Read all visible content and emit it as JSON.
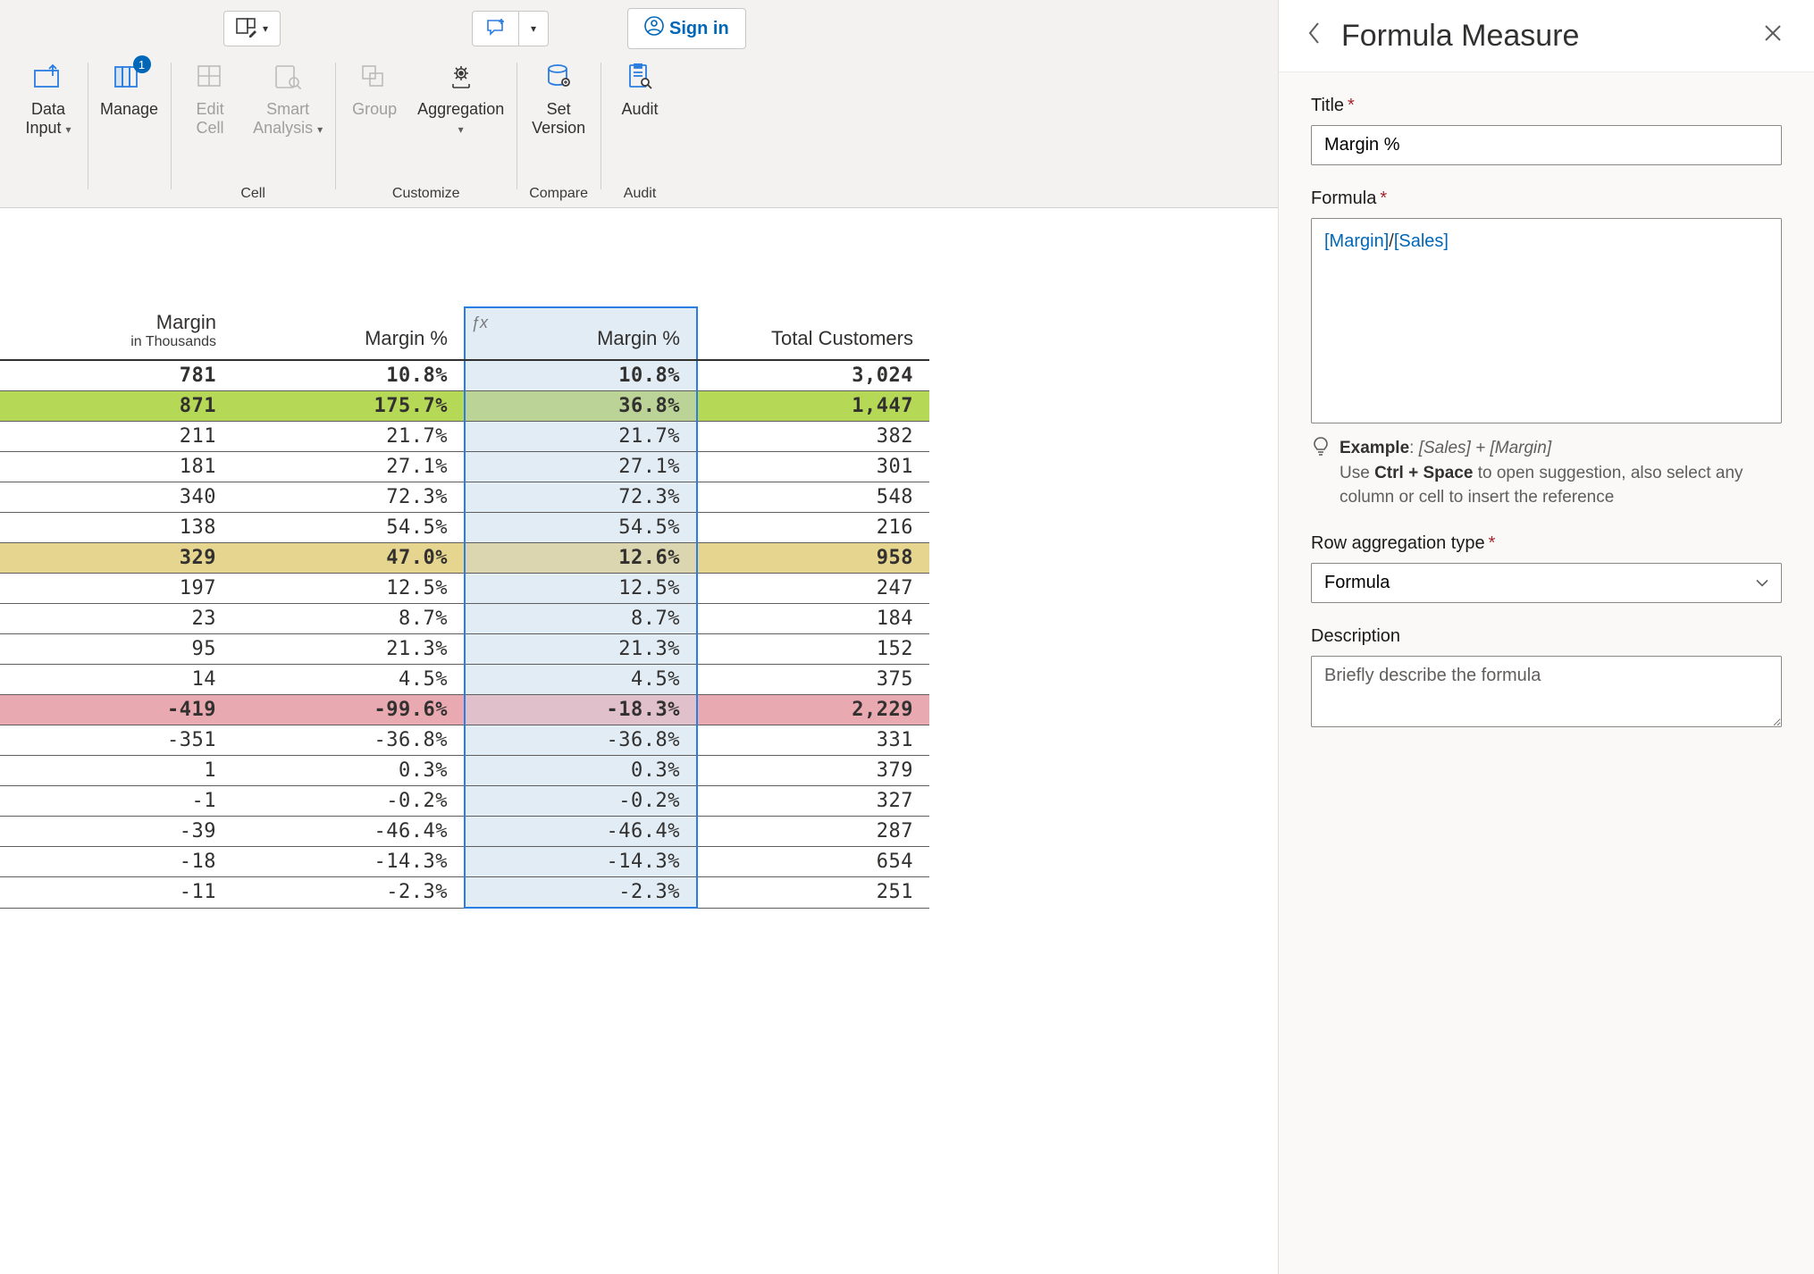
{
  "ribbon": {
    "sign_in": "Sign in",
    "groups": {
      "data_input": {
        "label": "Data\nInput"
      },
      "manage": {
        "label": "Manage",
        "badge": "1"
      },
      "cell": {
        "edit_cell": "Edit\nCell",
        "smart_analysis": "Smart\nAnalysis",
        "group_label": "Cell"
      },
      "customize": {
        "group": "Group",
        "aggregation": "Aggregation",
        "group_label": "Customize"
      },
      "compare": {
        "set_version": "Set\nVersion",
        "group_label": "Compare"
      },
      "audit": {
        "audit": "Audit",
        "group_label": "Audit"
      }
    }
  },
  "table": {
    "columns": {
      "margin": "Margin",
      "margin_sub": "in Thousands",
      "margin_pct1": "Margin %",
      "margin_pct2": "Margin %",
      "total_customers": "Total Customers"
    },
    "rows": [
      {
        "style": "bold",
        "margin": "781",
        "pct1": "10.8%",
        "pct2": "10.8%",
        "tc": "3,024"
      },
      {
        "style": "green bold",
        "margin": "871",
        "pct1": "175.7%",
        "pct2": "36.8%",
        "tc": "1,447"
      },
      {
        "style": "",
        "margin": "211",
        "pct1": "21.7%",
        "pct2": "21.7%",
        "tc": "382"
      },
      {
        "style": "",
        "margin": "181",
        "pct1": "27.1%",
        "pct2": "27.1%",
        "tc": "301"
      },
      {
        "style": "",
        "margin": "340",
        "pct1": "72.3%",
        "pct2": "72.3%",
        "tc": "548"
      },
      {
        "style": "",
        "margin": "138",
        "pct1": "54.5%",
        "pct2": "54.5%",
        "tc": "216"
      },
      {
        "style": "yellow bold",
        "margin": "329",
        "pct1": "47.0%",
        "pct2": "12.6%",
        "tc": "958"
      },
      {
        "style": "",
        "margin": "197",
        "pct1": "12.5%",
        "pct2": "12.5%",
        "tc": "247"
      },
      {
        "style": "",
        "margin": "23",
        "pct1": "8.7%",
        "pct2": "8.7%",
        "tc": "184"
      },
      {
        "style": "",
        "margin": "95",
        "pct1": "21.3%",
        "pct2": "21.3%",
        "tc": "152"
      },
      {
        "style": "",
        "margin": "14",
        "pct1": "4.5%",
        "pct2": "4.5%",
        "tc": "375"
      },
      {
        "style": "pink bold",
        "margin": "-419",
        "pct1": "-99.6%",
        "pct2": "-18.3%",
        "tc": "2,229"
      },
      {
        "style": "",
        "margin": "-351",
        "pct1": "-36.8%",
        "pct2": "-36.8%",
        "tc": "331"
      },
      {
        "style": "",
        "margin": "1",
        "pct1": "0.3%",
        "pct2": "0.3%",
        "tc": "379"
      },
      {
        "style": "",
        "margin": "-1",
        "pct1": "-0.2%",
        "pct2": "-0.2%",
        "tc": "327"
      },
      {
        "style": "",
        "margin": "-39",
        "pct1": "-46.4%",
        "pct2": "-46.4%",
        "tc": "287"
      },
      {
        "style": "",
        "margin": "-18",
        "pct1": "-14.3%",
        "pct2": "-14.3%",
        "tc": "654"
      },
      {
        "style": "",
        "margin": "-11",
        "pct1": "-2.3%",
        "pct2": "-2.3%",
        "tc": "251"
      }
    ]
  },
  "panel": {
    "title": "Formula Measure",
    "fields": {
      "title_label": "Title",
      "title_value": "Margin %",
      "formula_label": "Formula",
      "formula_tokens": [
        "[Margin]",
        "/",
        "[Sales]"
      ],
      "help_example_label": "Example",
      "help_example_value": "[Sales] + [Margin]",
      "help_text_before": "Use ",
      "help_ctrl_space": "Ctrl + Space",
      "help_text_after": " to open suggestion, also select any column or cell to insert the reference",
      "row_agg_label": "Row aggregation type",
      "row_agg_value": "Formula",
      "description_label": "Description",
      "description_placeholder": "Briefly describe the formula"
    }
  }
}
